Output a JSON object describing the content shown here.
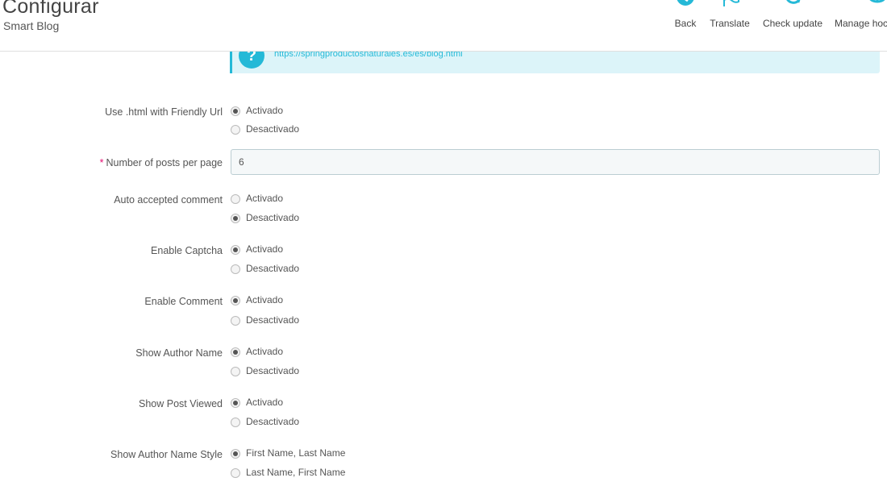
{
  "header": {
    "title": "Configurar",
    "subtitle": "Smart Blog",
    "toolbar": [
      {
        "label": "Back",
        "icon": "back-icon"
      },
      {
        "label": "Translate",
        "icon": "flag-icon"
      },
      {
        "label": "Check update",
        "icon": "refresh-icon"
      },
      {
        "label": "Manage hoc",
        "icon": "anchor-icon"
      }
    ]
  },
  "alert": {
    "icon": "?",
    "link": "https://springproductosnaturales.es/es/blog.html"
  },
  "form": {
    "html_friendly_url": {
      "label": "Use .html with Friendly Url",
      "options": [
        "Activado",
        "Desactivado"
      ],
      "selected": 0
    },
    "posts_per_page": {
      "required_mark": "*",
      "label": "Number of posts per page",
      "value": "6"
    },
    "auto_accepted_comment": {
      "label": "Auto accepted comment",
      "options": [
        "Activado",
        "Desactivado"
      ],
      "selected": 1
    },
    "enable_captcha": {
      "label": "Enable Captcha",
      "options": [
        "Activado",
        "Desactivado"
      ],
      "selected": 0
    },
    "enable_comment": {
      "label": "Enable Comment",
      "options": [
        "Activado",
        "Desactivado"
      ],
      "selected": 0
    },
    "show_author_name": {
      "label": "Show Author Name",
      "options": [
        "Activado",
        "Desactivado"
      ],
      "selected": 0
    },
    "show_post_viewed": {
      "label": "Show Post Viewed",
      "options": [
        "Activado",
        "Desactivado"
      ],
      "selected": 0
    },
    "author_name_style": {
      "label": "Show Author Name Style",
      "options": [
        "First Name, Last Name",
        "Last Name, First Name"
      ],
      "selected": 0
    }
  },
  "colors": {
    "accent": "#25b9d7",
    "alert_bg": "#dcf4f9",
    "required": "#e50b70"
  }
}
